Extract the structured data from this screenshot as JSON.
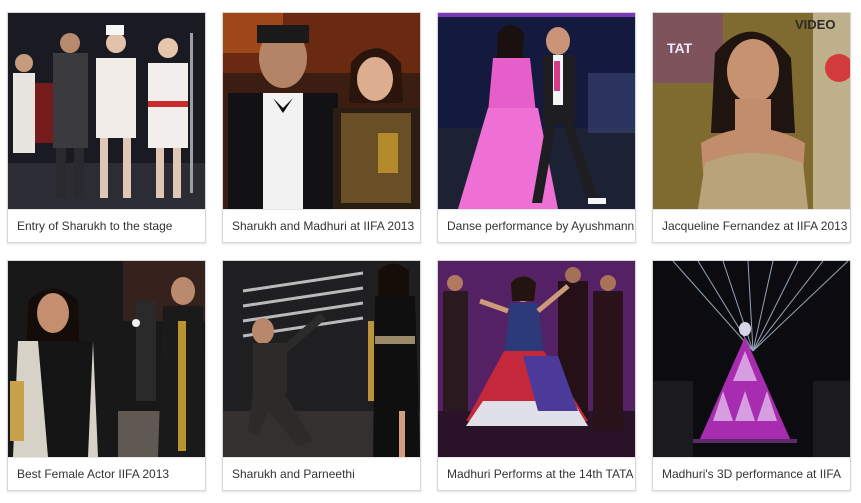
{
  "gallery": {
    "items": [
      {
        "caption": "Entry of Sharukh to the stage"
      },
      {
        "caption": "Sharukh and Madhuri at IIFA 2013"
      },
      {
        "caption": "Danse performance by Ayushmann"
      },
      {
        "caption": "Jacqueline Fernandez at IIFA 2013"
      },
      {
        "caption": "Best Female Actor IIFA 2013"
      },
      {
        "caption": "Sharukh and Parneethi"
      },
      {
        "caption": "Madhuri Performs at the 14th TATA IIFA"
      },
      {
        "caption": "Madhuri's 3D performance at IIFA"
      }
    ]
  }
}
